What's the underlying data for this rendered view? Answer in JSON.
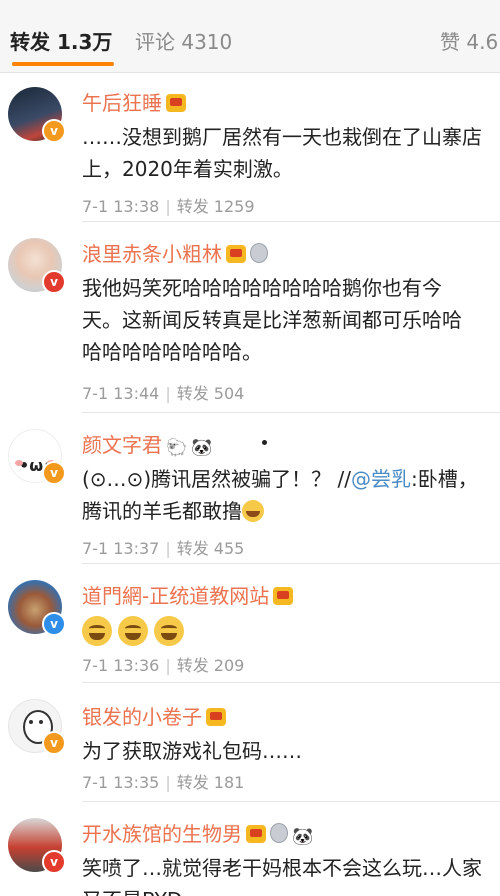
{
  "tabs": {
    "repost": "转发 1.3万",
    "comment": "评论 4310",
    "like": "赞 4.6"
  },
  "comments": [
    {
      "name": "午后狂睡",
      "badges": [
        "crown"
      ],
      "lines": [
        "……没想到鹅厂居然有一天也栽倒在了山寨店",
        "上，2020年着实刺激。"
      ],
      "time": "7-1 13:38",
      "repost": "转发 1259"
    },
    {
      "name": "浪里赤条小粗林",
      "badges": [
        "crown",
        "medal"
      ],
      "lines": [
        "我他妈笑死哈哈哈哈哈哈哈哈鹅你也有今",
        "天。这新闻反转真是比洋葱新闻都可乐哈哈",
        "哈哈哈哈哈哈哈哈。"
      ],
      "time": "7-1 13:44",
      "repost": "转发 504"
    },
    {
      "name": "颜文字君",
      "badges": [
        "sheep",
        "panda"
      ],
      "line1_a": "(⊙…⊙)腾讯居然被骗了！？ //",
      "line1_link": "@尝乳",
      "line1_b": ":卧槽，",
      "line2": "腾讯的羊毛都敢撸",
      "time": "7-1 13:37",
      "repost": "转发 455"
    },
    {
      "name": "道門網-正统道教网站",
      "badges": [
        "crown"
      ],
      "time": "7-1 13:36",
      "repost": "转发 209"
    },
    {
      "name": "银发的小卷子",
      "badges": [
        "crown"
      ],
      "lines": [
        "为了获取游戏礼包码……"
      ],
      "time": "7-1 13:35",
      "repost": "转发 181"
    },
    {
      "name": "开水族馆的生物男",
      "badges": [
        "crown",
        "medal",
        "panda"
      ],
      "lines": [
        "笑喷了…就觉得老干妈根本不会这么玩…人家",
        "又不是BYD"
      ]
    }
  ],
  "colors": {
    "accent": "#ff8200",
    "name": "#eb7350",
    "link": "#4a8bc6",
    "meta": "#9b9b9b"
  }
}
